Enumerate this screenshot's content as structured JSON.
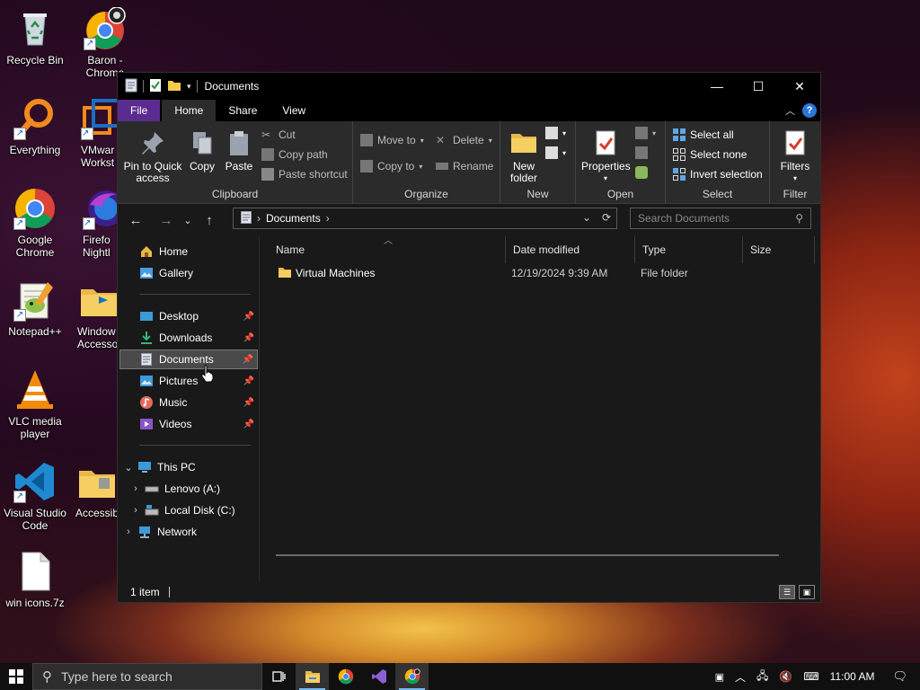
{
  "desktop": {
    "icons": [
      {
        "label": "Recycle Bin",
        "icon": "recycle-bin-icon"
      },
      {
        "label": "Baron - Chrome",
        "icon": "chrome-profile-icon"
      },
      {
        "label": "Everything",
        "icon": "everything-search-icon"
      },
      {
        "label": "VMware Workstation",
        "icon": "vmware-icon"
      },
      {
        "label": "Google Chrome",
        "icon": "chrome-icon"
      },
      {
        "label": "Firefox Nightly",
        "icon": "firefox-nightly-icon"
      },
      {
        "label": "Notepad++",
        "icon": "notepadpp-icon"
      },
      {
        "label": "Windows Accessories",
        "icon": "folder-icon"
      },
      {
        "label": "VLC media player",
        "icon": "vlc-icon"
      },
      {
        "label": "Visual Studio Code",
        "icon": "vscode-icon"
      },
      {
        "label": "Accessibility",
        "icon": "folder-icon"
      },
      {
        "label": "win icons.7z",
        "icon": "file-icon"
      }
    ]
  },
  "window": {
    "title": "Documents",
    "controls": {
      "minimize": "—",
      "maximize": "☐",
      "close": "✕"
    }
  },
  "ribbon_tabs": [
    "File",
    "Home",
    "Share",
    "View"
  ],
  "ribbon": {
    "clipboard": {
      "label": "Clipboard",
      "pin": "Pin to Quick access",
      "copy": "Copy",
      "paste": "Paste",
      "cut": "Cut",
      "copy_path": "Copy path",
      "paste_shortcut": "Paste shortcut"
    },
    "organize": {
      "label": "Organize",
      "move_to": "Move to",
      "copy_to": "Copy to",
      "delete": "Delete",
      "rename": "Rename"
    },
    "new": {
      "label": "New",
      "new_folder": "New folder"
    },
    "open": {
      "label": "Open",
      "properties": "Properties"
    },
    "select": {
      "label": "Select",
      "select_all": "Select all",
      "select_none": "Select none",
      "invert_selection": "Invert selection"
    },
    "filter": {
      "label": "Filter",
      "filters": "Filters"
    }
  },
  "address": {
    "path": "Documents",
    "search_placeholder": "Search Documents"
  },
  "nav": {
    "home": "Home",
    "gallery": "Gallery",
    "quick_access": [
      {
        "label": "Desktop",
        "icon": "desktop-icon"
      },
      {
        "label": "Downloads",
        "icon": "downloads-icon"
      },
      {
        "label": "Documents",
        "icon": "documents-icon",
        "selected": true
      },
      {
        "label": "Pictures",
        "icon": "pictures-icon"
      },
      {
        "label": "Music",
        "icon": "music-icon"
      },
      {
        "label": "Videos",
        "icon": "videos-icon"
      }
    ],
    "this_pc": "This PC",
    "drives": [
      "Lenovo (A:)",
      "Local Disk (C:)"
    ],
    "network": "Network"
  },
  "columns": [
    "Name",
    "Date modified",
    "Type",
    "Size"
  ],
  "files": [
    {
      "name": "Virtual Machines",
      "date": "12/19/2024 9:39 AM",
      "type": "File folder",
      "size": ""
    }
  ],
  "status": {
    "count": "1 item"
  },
  "taskbar": {
    "search_placeholder": "Type here to search",
    "time": "11:00 AM"
  },
  "colors": {
    "file_tab": "#5b2c8f",
    "ribbon": "#2b2b2b",
    "window_bg": "#191919",
    "accent": "#2b77d9"
  }
}
